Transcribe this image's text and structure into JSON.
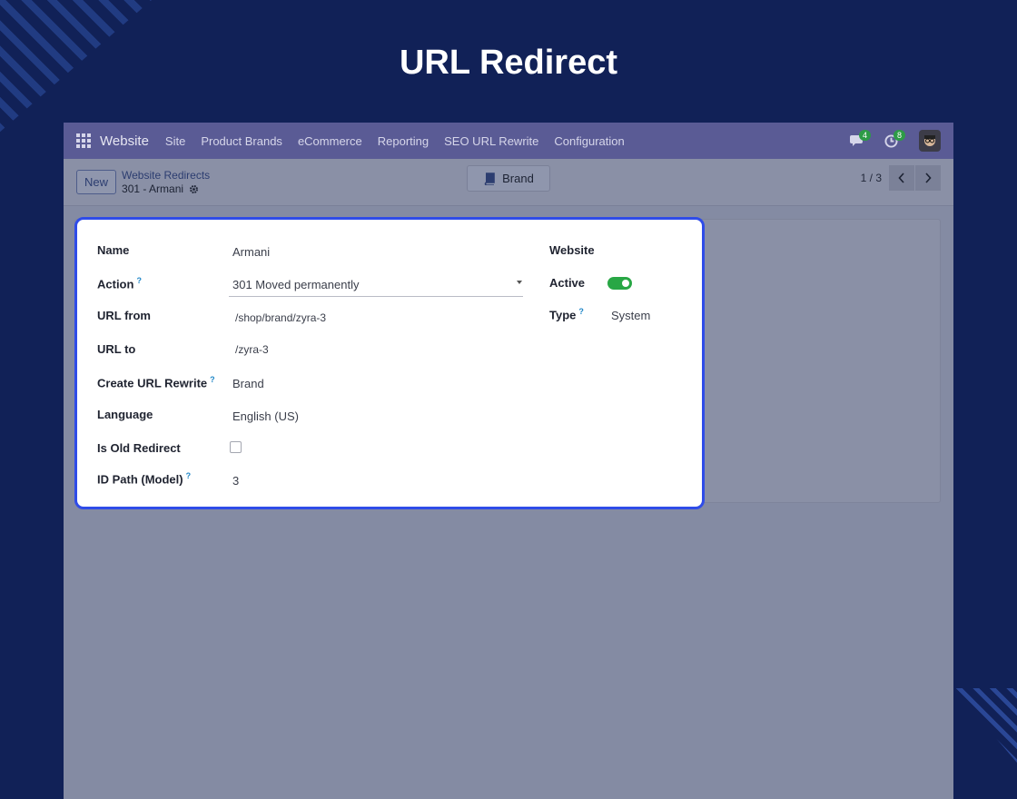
{
  "page": {
    "headline": "URL Redirect"
  },
  "navbar": {
    "brand": "Website",
    "items": [
      "Site",
      "Product Brands",
      "eCommerce",
      "Reporting",
      "SEO URL Rewrite",
      "Configuration"
    ],
    "messages_count": "4",
    "activities_count": "8"
  },
  "control": {
    "new_label": "New",
    "breadcrumb_parent": "Website Redirects",
    "breadcrumb_current": "301 - Armani",
    "smart_button": "Brand",
    "pager": "1 / 3"
  },
  "form": {
    "name_label": "Name",
    "name_value": "Armani",
    "action_label": "Action",
    "action_value": "301 Moved permanently",
    "url_from_label": "URL from",
    "url_from_value": "/shop/brand/zyra-3",
    "url_to_label": "URL to",
    "url_to_value": "/zyra-3",
    "rewrite_label": "Create URL Rewrite",
    "rewrite_value": "Brand",
    "language_label": "Language",
    "language_value": "English (US)",
    "old_redirect_label": "Is Old Redirect",
    "old_redirect_checked": false,
    "id_path_label": "ID Path (Model)",
    "id_path_value": "3",
    "website_label": "Website",
    "active_label": "Active",
    "active_on": true,
    "type_label": "Type",
    "type_value": "System",
    "help_mark": "?"
  },
  "colors": {
    "accent_border": "#2f4ce8",
    "toggle_on": "#28a745",
    "navbar": "#5a5b95",
    "background": "#112157"
  }
}
